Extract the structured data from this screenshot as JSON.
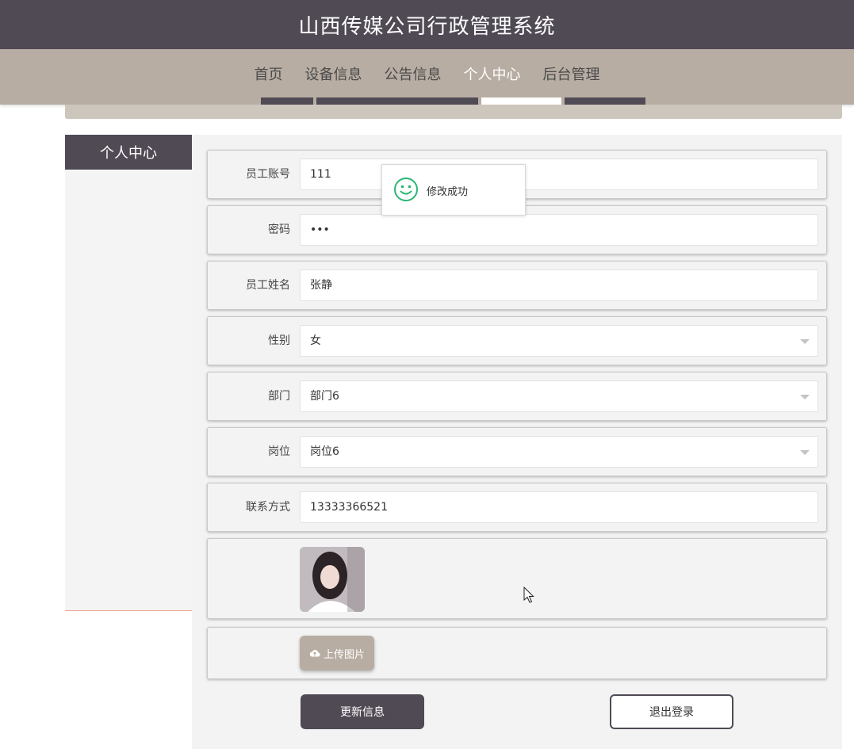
{
  "header": {
    "title": "山西传媒公司行政管理系统"
  },
  "nav": {
    "items": [
      {
        "label": "首页",
        "active": false
      },
      {
        "label": "设备信息",
        "active": false
      },
      {
        "label": "公告信息",
        "active": false
      },
      {
        "label": "个人中心",
        "active": true
      },
      {
        "label": "后台管理",
        "active": false
      }
    ]
  },
  "sidebar": {
    "title": "个人中心"
  },
  "form": {
    "account": {
      "label": "员工账号",
      "value": "111"
    },
    "password": {
      "label": "密码",
      "value": "•••"
    },
    "name": {
      "label": "员工姓名",
      "value": "张静"
    },
    "gender": {
      "label": "性别",
      "value": "女"
    },
    "department": {
      "label": "部门",
      "value": "部门6"
    },
    "position": {
      "label": "岗位",
      "value": "岗位6"
    },
    "phone": {
      "label": "联系方式",
      "value": "13333366521"
    },
    "upload_label": "上传图片",
    "update_label": "更新信息",
    "logout_label": "退出登录"
  },
  "toast": {
    "message": "修改成功",
    "icon": "smile-icon"
  },
  "colors": {
    "dark": "#504a55",
    "taupe": "#b8ada3",
    "success": "#2bb673"
  }
}
